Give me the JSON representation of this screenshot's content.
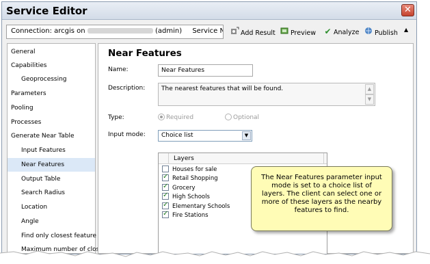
{
  "window": {
    "title": "Service Editor",
    "close_symbol": "✕"
  },
  "toolbar": {
    "connection_label": "Connection: arcgis on",
    "connection_user": "(admin)",
    "service_name_label": "Service Name: ...",
    "buttons": [
      {
        "label": "Add Result",
        "icon": "add-result-icon"
      },
      {
        "label": "Preview",
        "icon": "preview-icon"
      },
      {
        "label": "Analyze",
        "icon": "analyze-checkmark-icon"
      },
      {
        "label": "Publish",
        "icon": "publish-icon"
      }
    ],
    "collapse_symbol": "▲"
  },
  "sidebar": {
    "items": [
      {
        "label": "General"
      },
      {
        "label": "Capabilities"
      },
      {
        "label": "Geoprocessing"
      },
      {
        "label": "Parameters"
      },
      {
        "label": "Pooling"
      },
      {
        "label": "Processes"
      },
      {
        "label": "Generate Near Table"
      },
      {
        "label": "Input Features"
      },
      {
        "label": "Near Features"
      },
      {
        "label": "Output Table"
      },
      {
        "label": "Search Radius"
      },
      {
        "label": "Location"
      },
      {
        "label": "Angle"
      },
      {
        "label": "Find only closest feature"
      },
      {
        "label": "Maximum number of closest matches"
      }
    ]
  },
  "main": {
    "section_title": "Near Features",
    "name_label": "Name:",
    "name_value": "Near Features",
    "description_label": "Description:",
    "description_value": "The nearest features that will be found.",
    "type_label": "Type:",
    "type_options": [
      "Required",
      "Optional"
    ],
    "type_selected": "Required",
    "input_mode_label": "Input mode:",
    "input_mode_value": "Choice list",
    "layers_header": "Layers",
    "layers": [
      {
        "name": "Houses for sale",
        "checked": false
      },
      {
        "name": "Retail Shopping",
        "checked": true
      },
      {
        "name": "Grocery",
        "checked": true
      },
      {
        "name": "High Schools",
        "checked": true
      },
      {
        "name": "Elementary Schools",
        "checked": true
      },
      {
        "name": "Fire Stations",
        "checked": true
      }
    ]
  },
  "callout": {
    "text": "The Near Features parameter input mode is set to a choice list of layers.  The client can select one or more of these layers as the nearby features to find."
  },
  "colors": {
    "selected_nav": "#dbe8f7",
    "callout_bg": "#fffcb6",
    "close_button": "#c5442f",
    "check_green": "#1d7a1d"
  }
}
